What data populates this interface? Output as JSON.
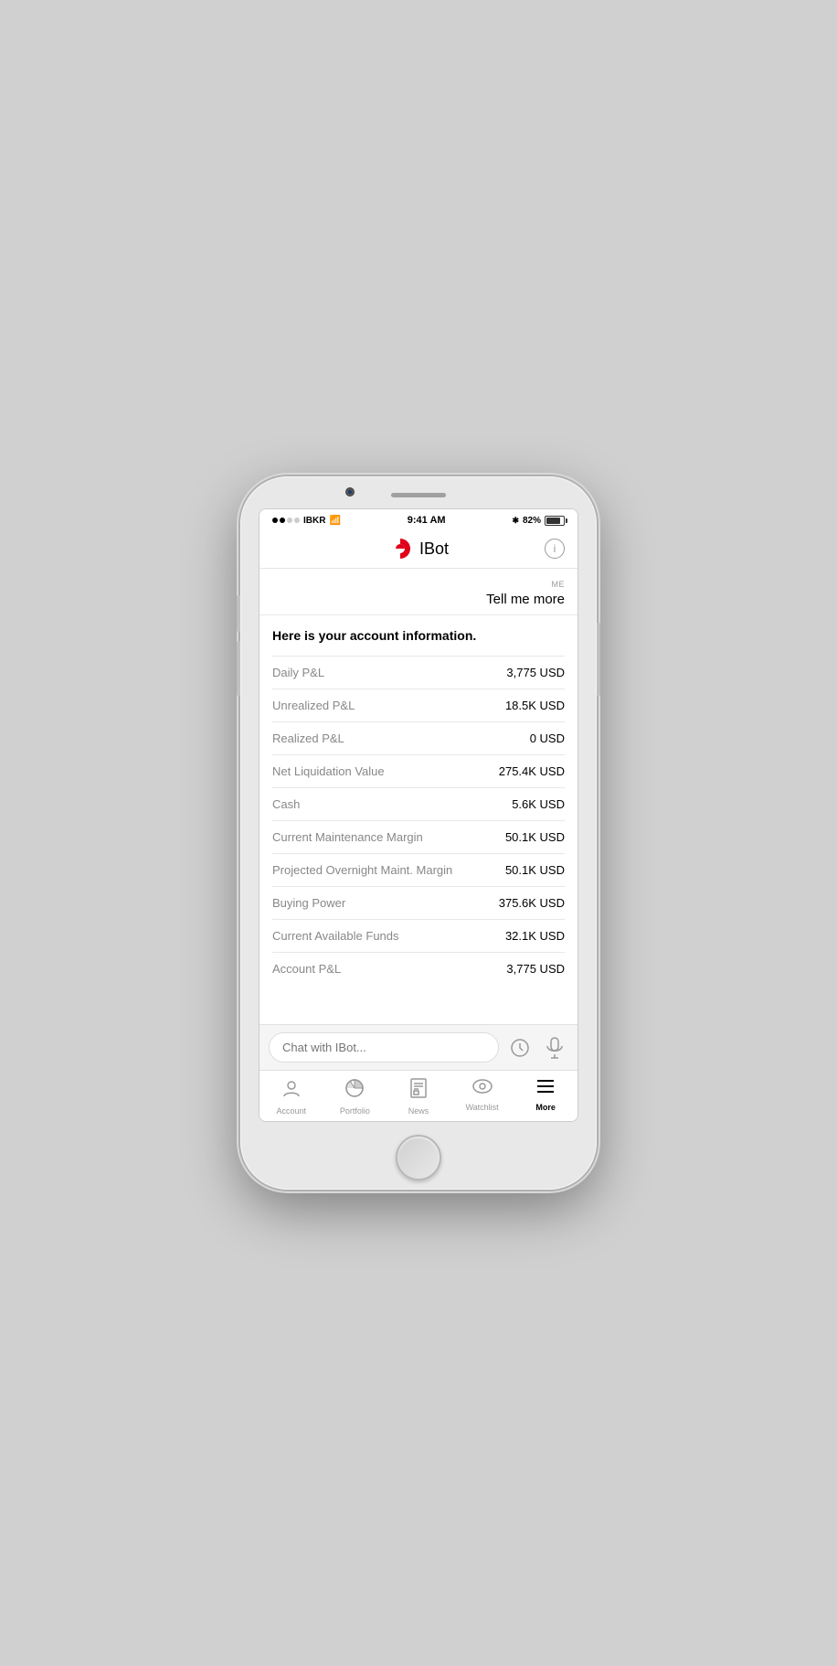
{
  "phone": {
    "statusBar": {
      "carrier": "IBKR",
      "time": "9:41 AM",
      "battery": "82%",
      "batteryFill": 82
    },
    "header": {
      "title": "IBot",
      "infoLabel": "i"
    },
    "chat": {
      "userLabel": "ME",
      "userMessage": "Tell me more",
      "botIntro": "Here is your account information.",
      "rows": [
        {
          "label": "Daily P&L",
          "value": "3,775 USD"
        },
        {
          "label": "Unrealized P&L",
          "value": "18.5K USD"
        },
        {
          "label": "Realized P&L",
          "value": "0 USD"
        },
        {
          "label": "Net Liquidation Value",
          "value": "275.4K USD"
        },
        {
          "label": "Cash",
          "value": "5.6K USD"
        },
        {
          "label": "Current Maintenance Margin",
          "value": "50.1K USD"
        },
        {
          "label": "Projected Overnight Maint. Margin",
          "value": "50.1K USD"
        },
        {
          "label": "Buying Power",
          "value": "375.6K USD"
        },
        {
          "label": "Current Available Funds",
          "value": "32.1K USD"
        },
        {
          "label": "Account P&L",
          "value": "3,775 USD"
        }
      ]
    },
    "inputArea": {
      "placeholder": "Chat with IBot..."
    },
    "tabBar": {
      "items": [
        {
          "id": "account",
          "label": "Account",
          "icon": "account",
          "active": false
        },
        {
          "id": "portfolio",
          "label": "Portfolio",
          "icon": "portfolio",
          "active": false
        },
        {
          "id": "news",
          "label": "News",
          "icon": "news",
          "active": false
        },
        {
          "id": "watchlist",
          "label": "Watchlist",
          "icon": "watchlist",
          "active": false
        },
        {
          "id": "more",
          "label": "More",
          "icon": "more",
          "active": true
        }
      ]
    }
  }
}
